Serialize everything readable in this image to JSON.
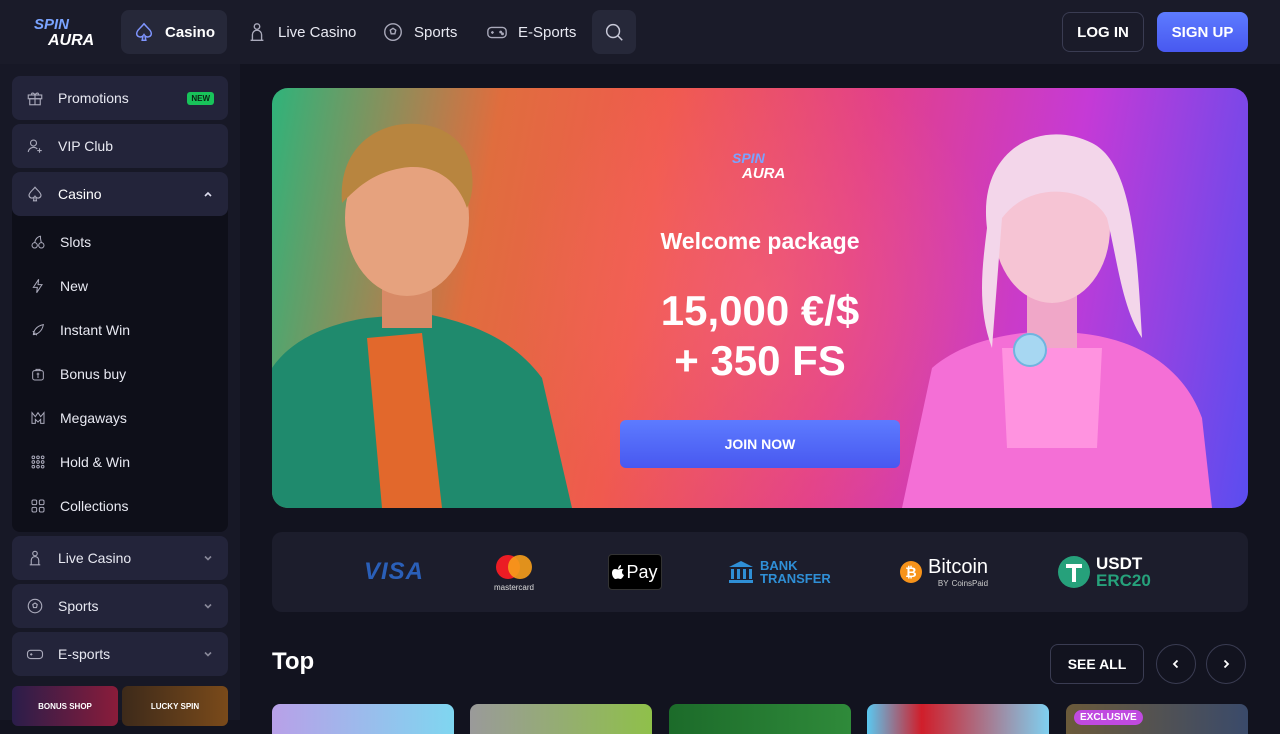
{
  "brand": {
    "logo_text_top": "SPIN",
    "logo_text_bottom": "AURA"
  },
  "topnav": {
    "items": [
      {
        "label": "Casino",
        "icon": "spade-icon",
        "active": true
      },
      {
        "label": "Live Casino",
        "icon": "dealer-icon"
      },
      {
        "label": "Sports",
        "icon": "soccer-ball-icon"
      },
      {
        "label": "E-Sports",
        "icon": "gamepad-icon"
      }
    ],
    "search_icon": "search-icon",
    "login_label": "LOG IN",
    "signup_label": "SIGN UP"
  },
  "sidebar": {
    "promotions": {
      "label": "Promotions",
      "badge": "NEW",
      "icon": "gift-icon"
    },
    "vip": {
      "label": "VIP Club",
      "icon": "vip-user-icon"
    },
    "casino": {
      "label": "Casino",
      "icon": "spade-icon",
      "items": [
        {
          "label": "Slots",
          "icon": "cherries-icon"
        },
        {
          "label": "New",
          "icon": "lightning-icon"
        },
        {
          "label": "Instant Win",
          "icon": "rocket-icon"
        },
        {
          "label": "Bonus buy",
          "icon": "bonus-bag-icon"
        },
        {
          "label": "Megaways",
          "icon": "megaways-icon"
        },
        {
          "label": "Hold & Win",
          "icon": "dots-grid-icon"
        },
        {
          "label": "Collections",
          "icon": "collections-icon"
        }
      ]
    },
    "live_casino": {
      "label": "Live Casino",
      "icon": "dealer-icon"
    },
    "sports": {
      "label": "Sports",
      "icon": "soccer-ball-icon"
    },
    "esports": {
      "label": "E-sports",
      "icon": "gamepad-icon"
    },
    "tiles": [
      "BONUS SHOP",
      "LUCKY SPIN"
    ]
  },
  "hero": {
    "title": "Welcome package",
    "amount_line1": "15,000 €/$",
    "amount_line2": "+ 350 FS",
    "cta": "JOIN NOW"
  },
  "payments": {
    "visa": "VISA",
    "mastercard": "mastercard",
    "applepay": "Pay",
    "bank_line1": "BANK",
    "bank_line2": "TRANSFER",
    "bitcoin": "Bitcoin",
    "bitcoin_sub_by": "BY",
    "bitcoin_sub": "CoinsPaid",
    "usdt_line1": "USDT",
    "usdt_line2": "ERC20"
  },
  "top_section": {
    "title": "Top",
    "see_all": "SEE ALL",
    "tile_badge": "EXCLUSIVE"
  },
  "colors": {
    "background": "#12131f",
    "accent": "#5468ff",
    "new_badge": "#18c35a"
  }
}
